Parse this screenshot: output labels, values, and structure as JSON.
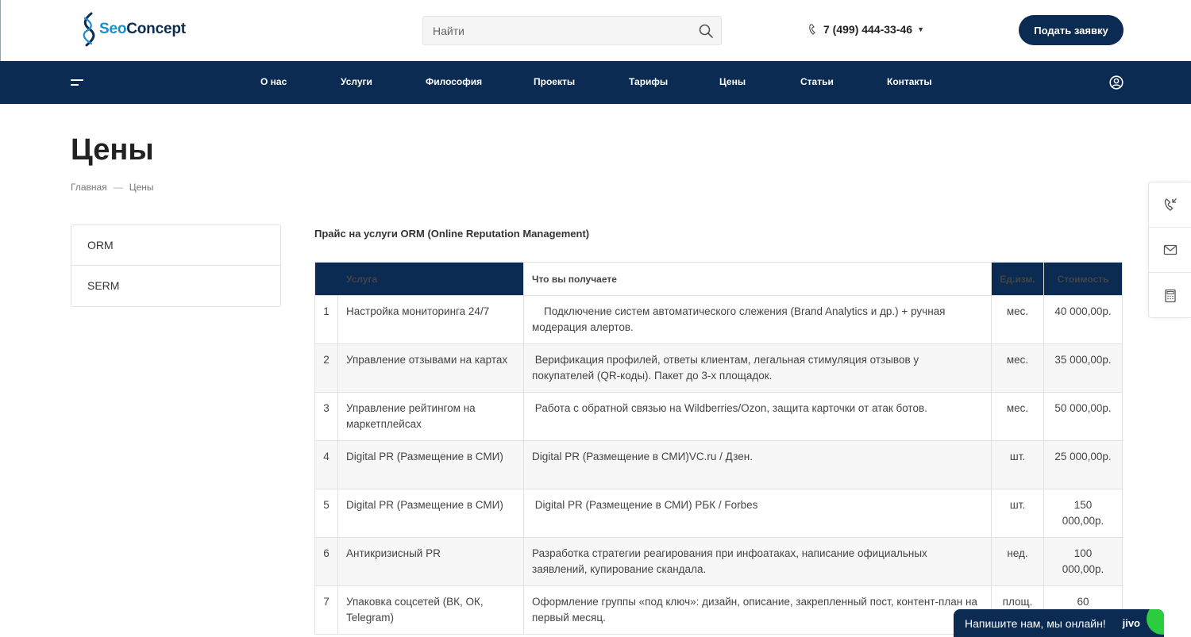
{
  "header": {
    "logo": {
      "part1": "Seo",
      "part2": "Concept"
    },
    "search": {
      "placeholder": "Найти"
    },
    "phone": "7 (499) 444-33-46",
    "cta_label": "Подать заявку"
  },
  "nav": {
    "items": [
      "О нас",
      "Услуги",
      "Философия",
      "Проекты",
      "Тарифы",
      "Цены",
      "Статьи",
      "Контакты"
    ]
  },
  "page": {
    "title": "Цены",
    "breadcrumb": {
      "home": "Главная",
      "separator": "—",
      "current": "Цены"
    }
  },
  "sidebar": {
    "items": [
      "ORM",
      "SERM"
    ]
  },
  "content": {
    "title": "Прайс на услуги ORM (Online Reputation Management)"
  },
  "table": {
    "headers": {
      "service": "Услуга",
      "receive": "Что вы получаете",
      "unit": "Ед.изм.",
      "price": "Стоимость"
    },
    "rows": [
      {
        "num": "1",
        "service": "Настройка мониторинга 24/7",
        "desc": "    Подключение систем автоматического слежения (Brand Analytics и др.) + ручная модерация алертов.",
        "unit": "мес.",
        "price": "40 000,00р."
      },
      {
        "num": "2",
        "service": "Управление отзывами на картах",
        "desc": " Верификация профилей, ответы клиентам, легальная стимуляция отзывов у покупателей (QR-коды). Пакет до 3-х площадок.",
        "unit": "мес.",
        "price": "35 000,00р."
      },
      {
        "num": "3",
        "service": "Управление рейтингом на маркетплейсах",
        "desc": " Работа с обратной связью на Wildberries/Ozon, защита карточки от атак ботов.",
        "unit": "мес.",
        "price": "50 000,00р."
      },
      {
        "num": "4",
        "service": "Digital PR (Размещение в СМИ)",
        "desc": "Digital PR (Размещение в СМИ)VC.ru / Дзен.",
        "unit": "шт.",
        "price": "25 000,00р."
      },
      {
        "num": "5",
        "service": "Digital PR (Размещение в СМИ)",
        "desc": " Digital PR (Размещение в СМИ) РБК / Forbes",
        "unit": "шт.",
        "price": "150 000,00р."
      },
      {
        "num": "6",
        "service": "Антикризисный PR",
        "desc": "Разработка стратегии реагирования при инфоатаках, написание официальных заявлений, купирование скандала.",
        "unit": "нед.",
        "price": "100 000,00р."
      },
      {
        "num": "7",
        "service": "Упаковка соцсетей (ВК, ОК, Telegram)",
        "desc": "Оформление группы «под ключ»: дизайн, описание, закрепленный пост, контент-план на первый месяц.",
        "unit": "площ.",
        "price": "60"
      }
    ]
  },
  "chat": {
    "label": "Напишите нам, мы онлайн!",
    "brand": "jivo"
  },
  "colors": {
    "brand_dark": "#0b2b52",
    "brand_blue": "#1a8fc9",
    "online_green": "#2ecc40"
  },
  "icons": {
    "search": "search-icon",
    "phone": "phone-icon",
    "menu": "burger-menu-icon",
    "user": "user-icon",
    "callback": "callback-phone-icon",
    "mail": "mail-icon",
    "calculator": "calculator-icon"
  }
}
